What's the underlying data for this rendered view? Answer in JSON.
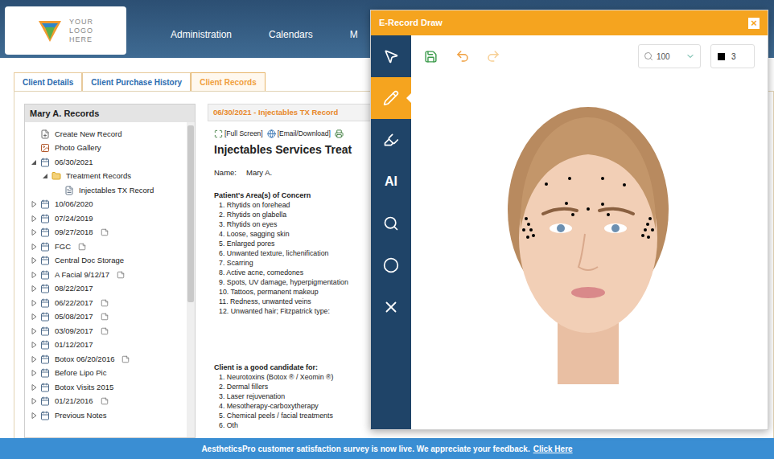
{
  "header": {
    "logo": {
      "lines": [
        "YOUR",
        "LOGO",
        "HERE"
      ]
    },
    "nav": [
      "Administration",
      "Calendars",
      "M"
    ]
  },
  "tabs": [
    {
      "label": "Client Details",
      "selected": false
    },
    {
      "label": "Client Purchase History",
      "selected": false
    },
    {
      "label": "Client Records",
      "selected": true
    }
  ],
  "records": {
    "title": "Mary A. Records",
    "items": [
      {
        "label": "Create New Record",
        "depth": 0,
        "kind": "action",
        "expandable": false,
        "expanded": false,
        "note": false
      },
      {
        "label": "Photo Gallery",
        "depth": 0,
        "kind": "gallery",
        "expandable": false,
        "expanded": false,
        "note": false
      },
      {
        "label": "06/30/2021",
        "depth": 0,
        "kind": "record",
        "expandable": true,
        "expanded": true,
        "note": false
      },
      {
        "label": "Treatment Records",
        "depth": 1,
        "kind": "folder",
        "expandable": true,
        "expanded": true,
        "note": false
      },
      {
        "label": "Injectables TX Record",
        "depth": 2,
        "kind": "document",
        "expandable": false,
        "expanded": false,
        "note": false
      },
      {
        "label": "10/06/2020",
        "depth": 0,
        "kind": "record",
        "expandable": true,
        "expanded": false,
        "note": false
      },
      {
        "label": "07/24/2019",
        "depth": 0,
        "kind": "record",
        "expandable": true,
        "expanded": false,
        "note": false
      },
      {
        "label": "09/27/2018",
        "depth": 0,
        "kind": "record",
        "expandable": true,
        "expanded": false,
        "note": true
      },
      {
        "label": "FGC",
        "depth": 0,
        "kind": "record",
        "expandable": true,
        "expanded": false,
        "note": true
      },
      {
        "label": "Central Doc Storage",
        "depth": 0,
        "kind": "record",
        "expandable": true,
        "expanded": false,
        "note": false
      },
      {
        "label": "A Facial 9/12/17",
        "depth": 0,
        "kind": "record",
        "expandable": true,
        "expanded": false,
        "note": true
      },
      {
        "label": "08/22/2017",
        "depth": 0,
        "kind": "record",
        "expandable": true,
        "expanded": false,
        "note": false
      },
      {
        "label": "06/22/2017",
        "depth": 0,
        "kind": "record",
        "expandable": true,
        "expanded": false,
        "note": true
      },
      {
        "label": "05/08/2017",
        "depth": 0,
        "kind": "record",
        "expandable": true,
        "expanded": false,
        "note": true
      },
      {
        "label": "03/09/2017",
        "depth": 0,
        "kind": "record",
        "expandable": true,
        "expanded": false,
        "note": true
      },
      {
        "label": "01/12/2017",
        "depth": 0,
        "kind": "record",
        "expandable": true,
        "expanded": false,
        "note": false
      },
      {
        "label": "Botox 06/20/2016",
        "depth": 0,
        "kind": "record",
        "expandable": true,
        "expanded": false,
        "note": true
      },
      {
        "label": "Before Lipo Pic",
        "depth": 0,
        "kind": "record",
        "expandable": true,
        "expanded": false,
        "note": false
      },
      {
        "label": "Botox Visits 2015",
        "depth": 0,
        "kind": "record",
        "expandable": true,
        "expanded": false,
        "note": false
      },
      {
        "label": "01/21/2016",
        "depth": 0,
        "kind": "record",
        "expandable": true,
        "expanded": false,
        "note": true
      },
      {
        "label": "Previous Notes",
        "depth": 0,
        "kind": "record",
        "expandable": true,
        "expanded": false,
        "note": false
      }
    ]
  },
  "record": {
    "header": "06/30/2021 - Injectables TX Record",
    "toolbar": [
      {
        "kind": "fullscreen",
        "label": "[Full Screen]"
      },
      {
        "kind": "email",
        "label": "[Email/Download]"
      }
    ],
    "heading": "Injectables Services Treat",
    "name_label": "Name:",
    "name_value": "Mary A.",
    "concerns_title": "Patient's Area(s) of Concern",
    "concerns": [
      "1. Rhytids on forehead",
      "2. Rhytids on glabella",
      "3. Rhytids on eyes",
      "4. Loose, sagging skin",
      "5. Enlarged pores",
      "6. Unwanted texture, lichenification",
      "7. Scarring",
      "8. Active acne, comedones",
      "9. Spots, UV damage, hyperpigmentation",
      "10. Tattoos, permanent makeup",
      "11. Redness, unwanted veins",
      "12. Unwanted hair; Fitzpatrick type:"
    ],
    "candidate_title": "Client is a good candidate for:",
    "candidates": [
      "1. Neurotoxins (Botox ® / Xeomin ®)",
      "2. Dermal fillers",
      "3. Laser rejuvenation",
      "4. Mesotherapy-carboxytherapy",
      "5. Chemical peels / facial treatments",
      "6. Oth"
    ]
  },
  "draw_window": {
    "title": "E-Record Draw",
    "close": "×",
    "tools": [
      {
        "kind": "pointer",
        "label": "",
        "selected": false
      },
      {
        "kind": "pencil",
        "label": "",
        "selected": true
      },
      {
        "kind": "highlighter",
        "label": "",
        "selected": false
      },
      {
        "kind": "text",
        "label": "AI",
        "selected": false
      },
      {
        "kind": "zoom",
        "label": "",
        "selected": false
      },
      {
        "kind": "circle",
        "label": "",
        "selected": false
      },
      {
        "kind": "clear",
        "label": "",
        "selected": false
      }
    ],
    "undo": {
      "disabled": false
    },
    "redo": {
      "disabled": true
    },
    "zoom": "100",
    "stroke_width": "3",
    "stroke_color": "#000000"
  },
  "footer": {
    "text": "AestheticsPro customer satisfaction survey is now live. We appreciate your feedback.",
    "link": "Click Here"
  }
}
